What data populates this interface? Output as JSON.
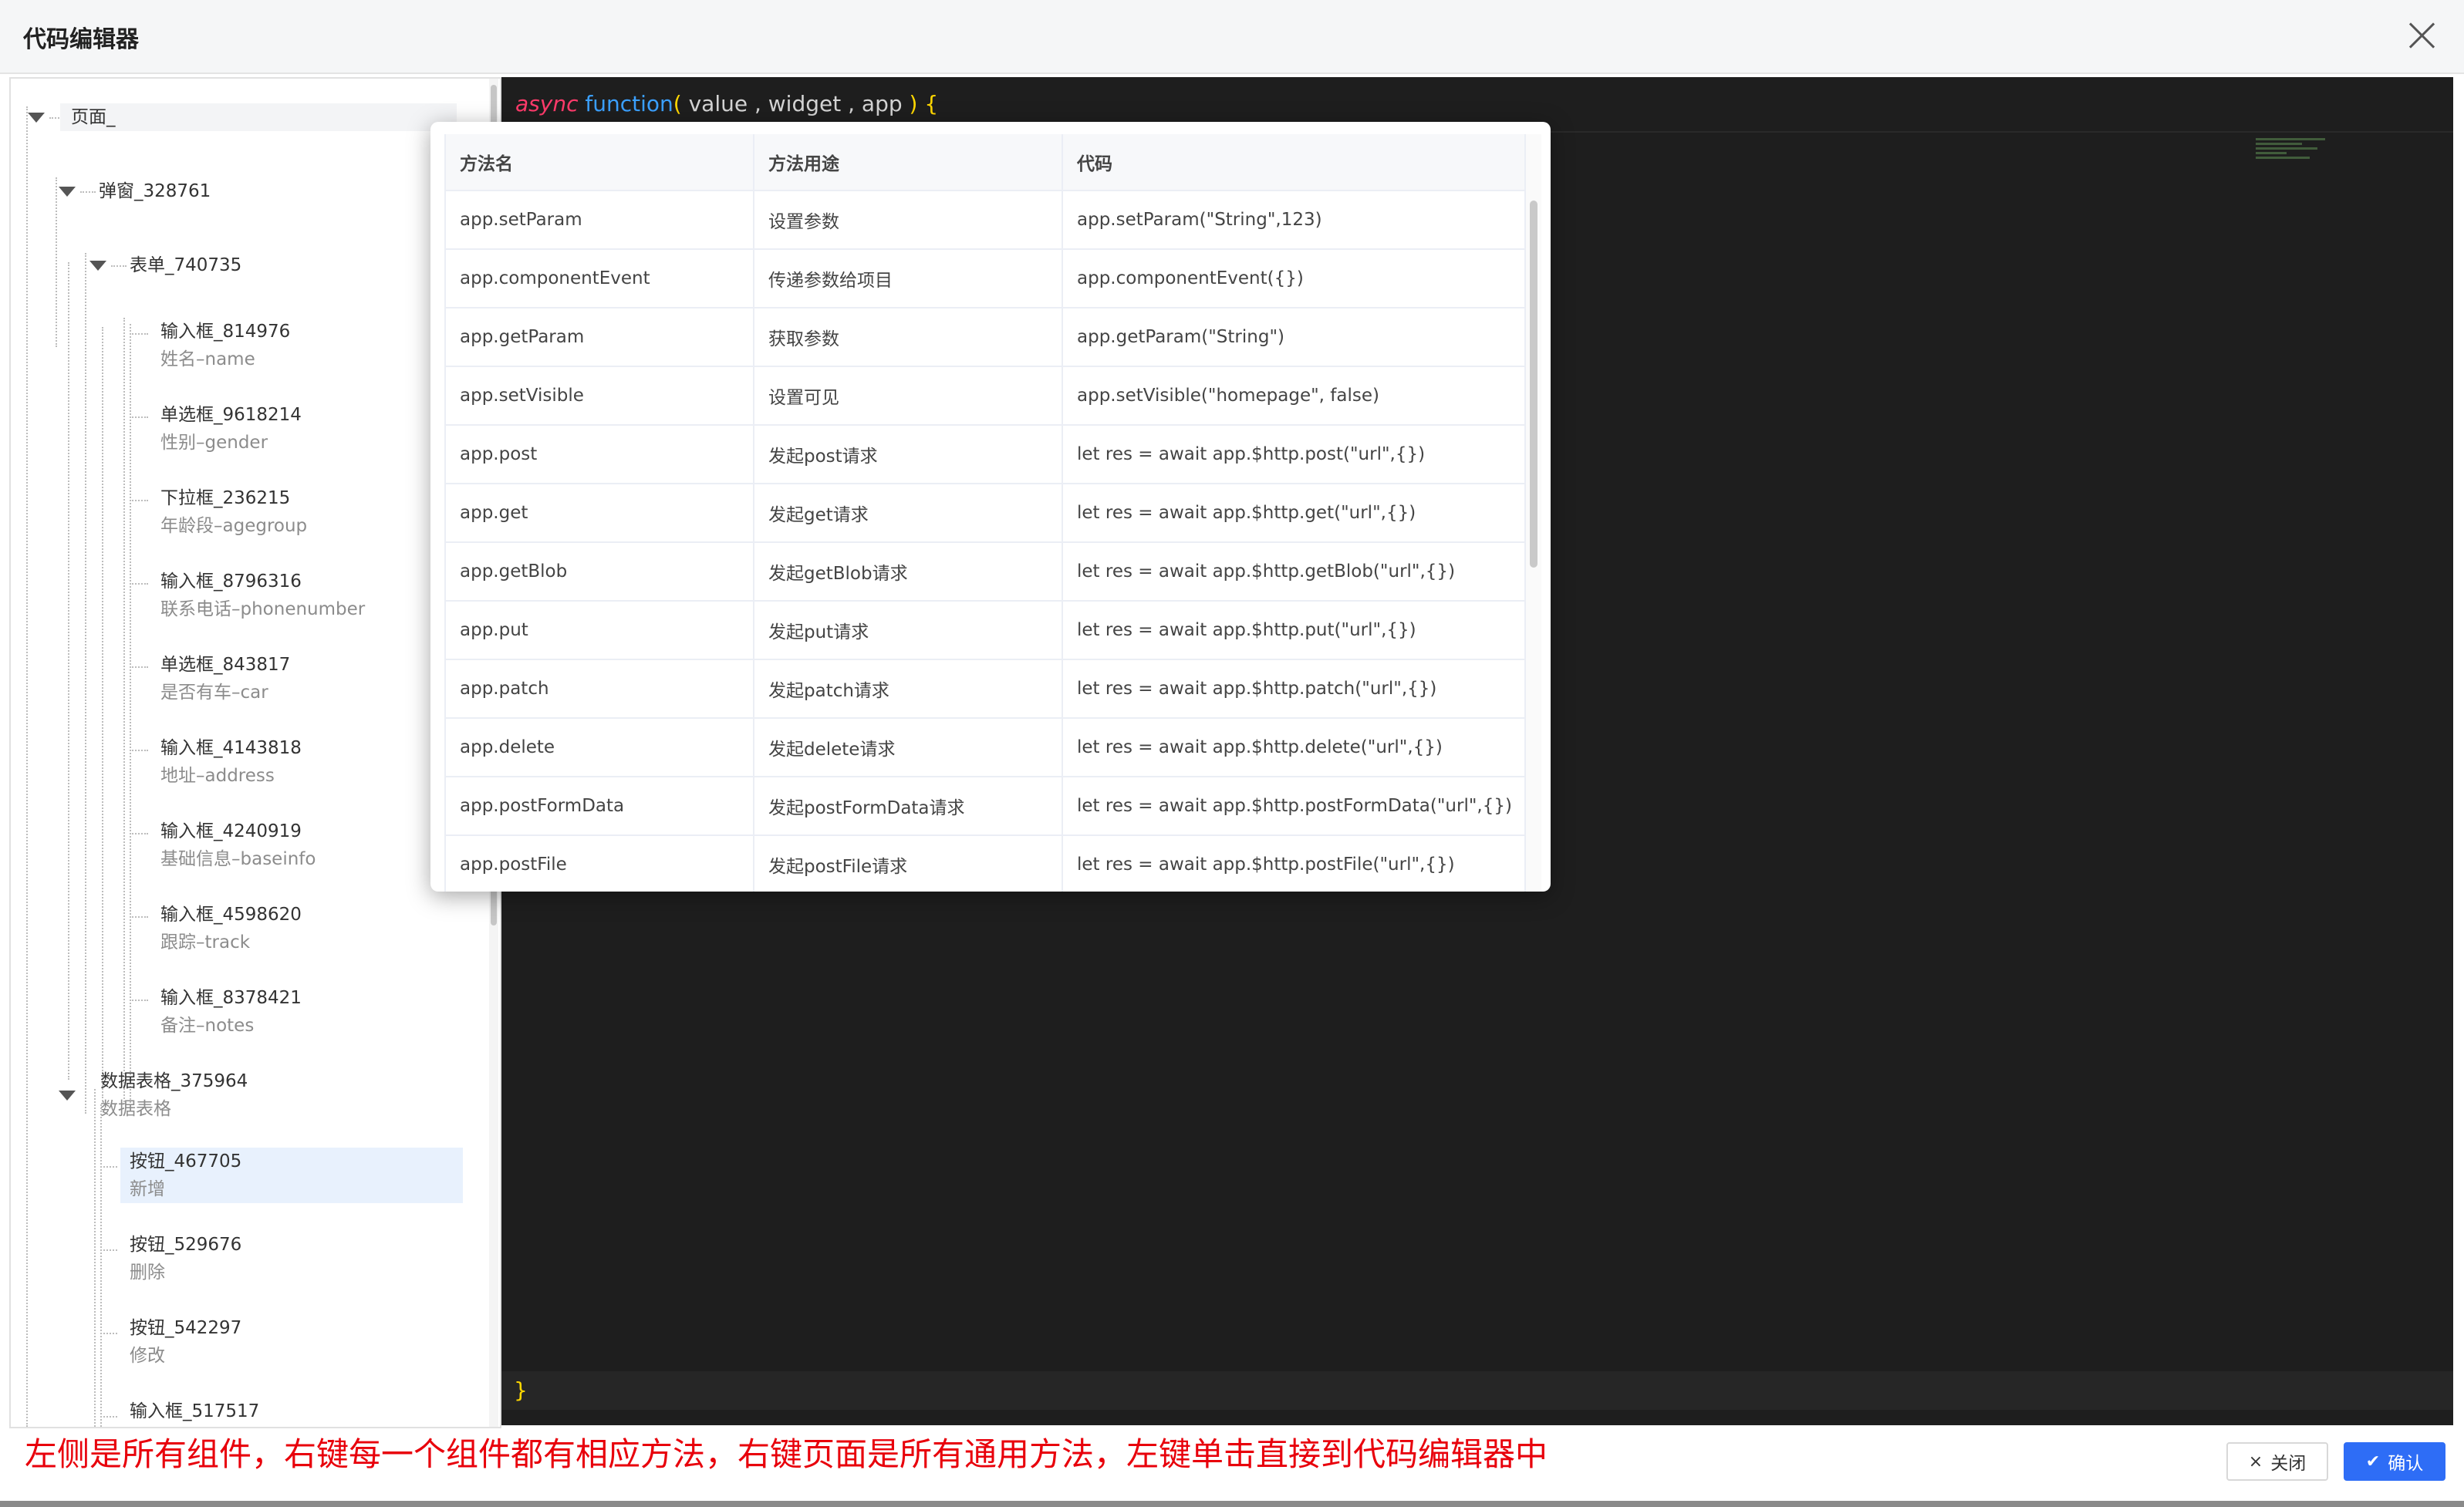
{
  "dialog": {
    "title": "代码编辑器"
  },
  "tree": {
    "root": "页面_",
    "popup_node": "弹窗_328761",
    "form_node": "表单_740735",
    "form_children": [
      {
        "title": "输入框_814976",
        "sub": "姓名–name"
      },
      {
        "title": "单选框_9618214",
        "sub": "性别–gender"
      },
      {
        "title": "下拉框_236215",
        "sub": "年龄段–agegroup"
      },
      {
        "title": "输入框_8796316",
        "sub": "联系电话–phonenumber"
      },
      {
        "title": "单选框_843817",
        "sub": "是否有车–car"
      },
      {
        "title": "输入框_4143818",
        "sub": "地址–address"
      },
      {
        "title": "输入框_4240919",
        "sub": "基础信息–baseinfo"
      },
      {
        "title": "输入框_4598620",
        "sub": "跟踪–track"
      },
      {
        "title": "输入框_8378421",
        "sub": "备注–notes"
      }
    ],
    "table_node": {
      "title": "数据表格_375964",
      "sub": "数据表格"
    },
    "table_children": [
      {
        "title": "按钮_467705",
        "sub": "新增"
      },
      {
        "title": "按钮_529676",
        "sub": "删除"
      },
      {
        "title": "按钮_542297",
        "sub": "修改"
      },
      {
        "title": "输入框_517517",
        "sub": ""
      }
    ]
  },
  "editor": {
    "kw_async": "async",
    "kw_function": "function",
    "paren_open": "(",
    "params": " value , widget , app ",
    "paren_close": ")",
    "brace_open": " {",
    "brace_close": "}"
  },
  "methods": {
    "headers": [
      "方法名",
      "方法用途",
      "代码"
    ],
    "rows": [
      [
        "app.setParam",
        "设置参数",
        "app.setParam(\"String\",123)"
      ],
      [
        "app.componentEvent",
        "传递参数给项目",
        "app.componentEvent({})"
      ],
      [
        "app.getParam",
        "获取参数",
        "app.getParam(\"String\")"
      ],
      [
        "app.setVisible",
        "设置可见",
        "app.setVisible(\"homepage\", false)"
      ],
      [
        "app.post",
        "发起post请求",
        "let res = await app.$http.post(\"url\",{})"
      ],
      [
        "app.get",
        "发起get请求",
        "let res = await app.$http.get(\"url\",{})"
      ],
      [
        "app.getBlob",
        "发起getBlob请求",
        "let res = await app.$http.getBlob(\"url\",{})"
      ],
      [
        "app.put",
        "发起put请求",
        "let res = await app.$http.put(\"url\",{})"
      ],
      [
        "app.patch",
        "发起patch请求",
        "let res = await app.$http.patch(\"url\",{})"
      ],
      [
        "app.delete",
        "发起delete请求",
        "let res = await app.$http.delete(\"url\",{})"
      ],
      [
        "app.postFormData",
        "发起postFormData请求",
        "let res = await app.$http.postFormData(\"url\",{})"
      ],
      [
        "app.postFile",
        "发起postFile请求",
        "let res = await app.$http.postFile(\"url\",{})"
      ]
    ]
  },
  "footer": {
    "note": "左侧是所有组件，右键每一个组件都有相应方法，右键页面是所有通用方法，左键单击直接到代码编辑器中",
    "close_label": "关闭",
    "ok_label": "确认",
    "close_icon": "×",
    "ok_icon": "✔"
  },
  "colors": {
    "keyword_async": "#ff3b6b",
    "keyword_function": "#3ba0ff",
    "bracket": "#ffd700",
    "note_red": "#e8000b",
    "primary_button": "#2e6df6"
  }
}
